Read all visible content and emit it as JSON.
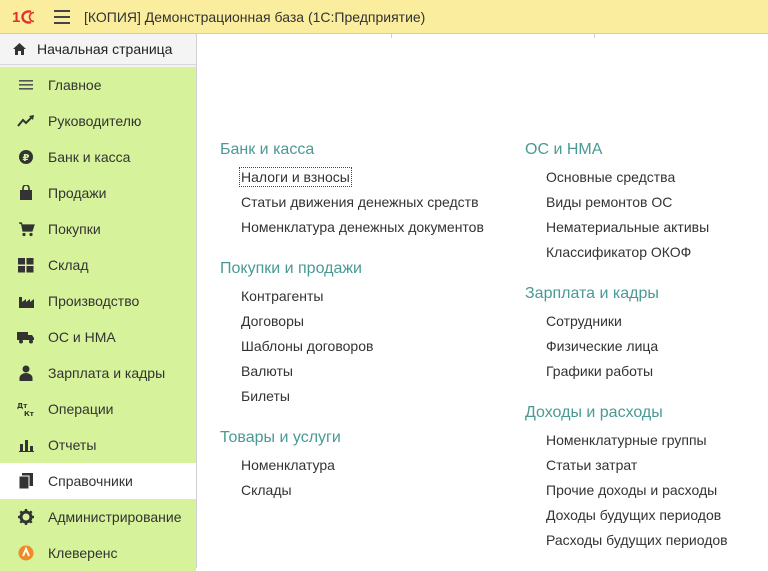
{
  "header": {
    "logo_text": "1С",
    "title": "[КОПИЯ] Демонстрационная база  (1С:Предприятие)"
  },
  "sidebar": {
    "home_label": "Начальная страница",
    "items": [
      {
        "label": "Главное",
        "icon": "menu-lines-icon"
      },
      {
        "label": "Руководителю",
        "icon": "trend-up-icon"
      },
      {
        "label": "Банк и касса",
        "icon": "coin-icon"
      },
      {
        "label": "Продажи",
        "icon": "shopping-bag-icon"
      },
      {
        "label": "Покупки",
        "icon": "cart-icon"
      },
      {
        "label": "Склад",
        "icon": "warehouse-grid-icon"
      },
      {
        "label": "Производство",
        "icon": "factory-icon"
      },
      {
        "label": "ОС и НМА",
        "icon": "truck-icon"
      },
      {
        "label": "Зарплата и кадры",
        "icon": "person-icon"
      },
      {
        "label": "Операции",
        "icon": "debit-credit-icon"
      },
      {
        "label": "Отчеты",
        "icon": "bar-chart-icon"
      },
      {
        "label": "Справочники",
        "icon": "book-icon",
        "active": true
      },
      {
        "label": "Администрирование",
        "icon": "gear-icon"
      },
      {
        "label": "Клеверенс",
        "icon": "cleverence-icon"
      }
    ]
  },
  "content": {
    "left_groups": [
      {
        "title": "Банк и касса",
        "links": [
          "Налоги и взносы",
          "Статьи движения денежных средств",
          "Номенклатура денежных документов"
        ]
      },
      {
        "title": "Покупки и продажи",
        "links": [
          "Контрагенты",
          "Договоры",
          "Шаблоны договоров",
          "Валюты",
          "Билеты"
        ]
      },
      {
        "title": "Товары и услуги",
        "links": [
          "Номенклатура",
          "Склады"
        ]
      }
    ],
    "right_groups": [
      {
        "title": "ОС и НМА",
        "links": [
          "Основные средства",
          "Виды ремонтов ОС",
          "Нематериальные активы",
          "Классификатор ОКОФ"
        ]
      },
      {
        "title": "Зарплата и кадры",
        "links": [
          "Сотрудники",
          "Физические лица",
          "Графики работы"
        ]
      },
      {
        "title": "Доходы и расходы",
        "links": [
          "Номенклатурные группы",
          "Статьи затрат",
          "Прочие доходы и расходы",
          "Доходы будущих периодов",
          "Расходы будущих периодов"
        ]
      }
    ],
    "focused_link": "Налоги и взносы"
  },
  "colors": {
    "header_bg": "#fbed9e",
    "sidebar_sections_bg": "#d6f29a",
    "group_title": "#4a9a94",
    "logo_red": "#e2302c"
  }
}
